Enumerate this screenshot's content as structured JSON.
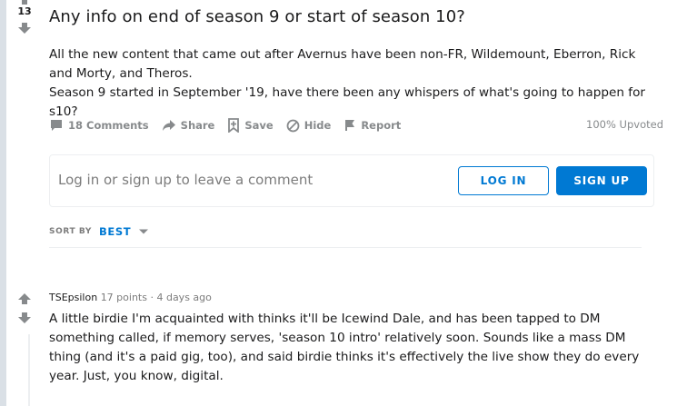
{
  "post": {
    "score": "13",
    "title": "Any info on end of season 9 or start of season 10?",
    "body_paragraph_1": "All the new content that came out after Avernus have been non-FR, Wildemount, Eberron, Rick and Morty, and Theros.",
    "body_paragraph_2": "Season 9 started in September '19, have there been any whispers of what's going to happen for s10?",
    "actions": {
      "comments": "18 Comments",
      "share": "Share",
      "save": "Save",
      "hide": "Hide",
      "report": "Report"
    },
    "upvoted": "100% Upvoted"
  },
  "comment_prompt": {
    "text": "Log in or sign up to leave a comment",
    "login_label": "LOG IN",
    "signup_label": "SIGN UP"
  },
  "sort": {
    "label": "SORT BY",
    "value": "BEST"
  },
  "comments": [
    {
      "author": "TSEpsilon",
      "points": "17 points",
      "separator": "·",
      "time": "4 days ago",
      "body": "A little birdie I'm acquainted with thinks it'll be Icewind Dale, and has been tapped to DM something called, if memory serves, 'season 10 intro' relatively soon. Sounds like a mass DM thing (and it's a paid gig, too), and said birdie thinks it's effectively the live show they do every year. Just, you know, digital."
    }
  ],
  "colors": {
    "accent": "#0079d3",
    "muted": "#878a8c",
    "text": "#1a1a1b",
    "rail": "#dae0e6"
  }
}
